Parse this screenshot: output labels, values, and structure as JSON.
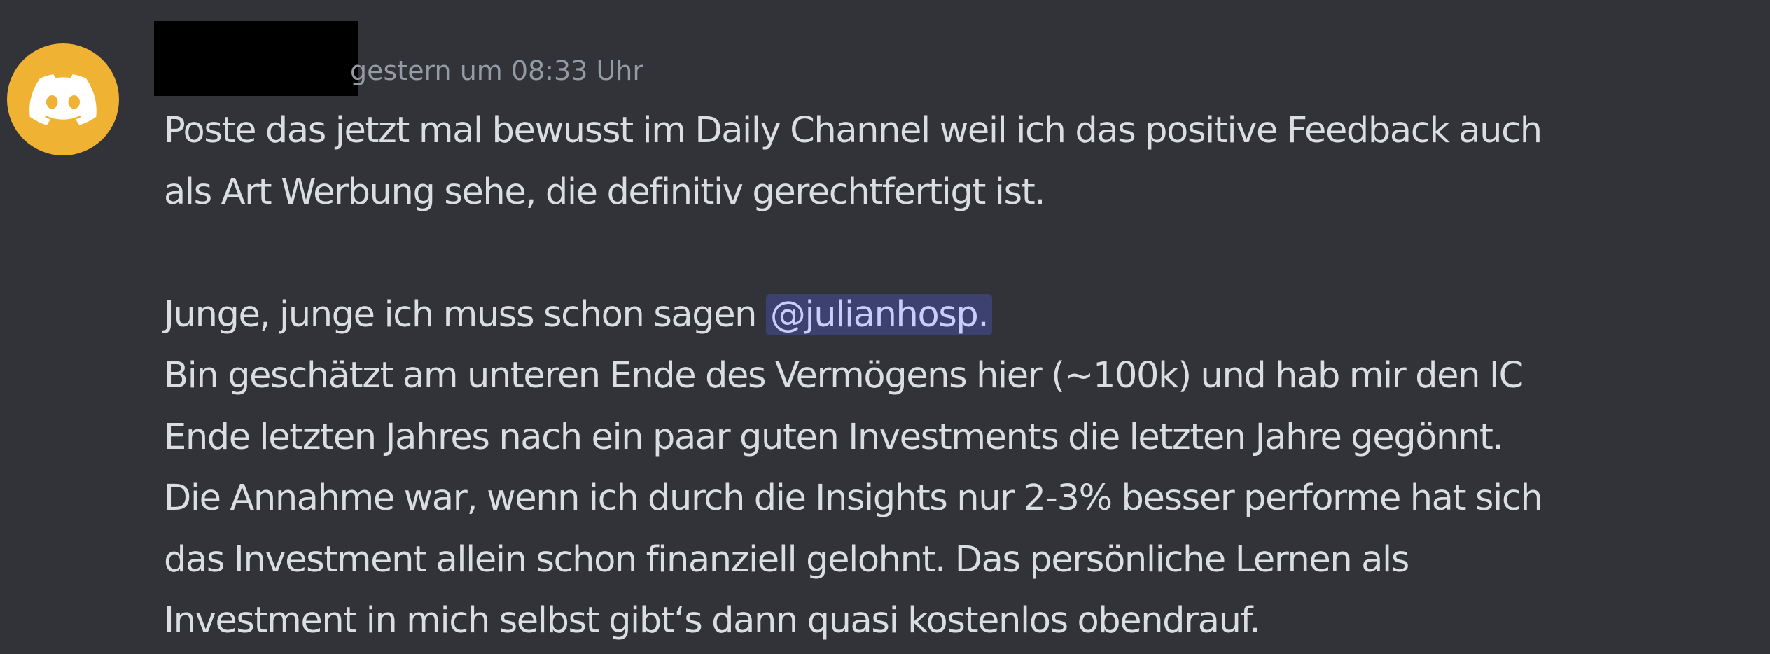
{
  "message": {
    "avatar_icon": "discord-logo-icon",
    "avatar_color": "#f0b232",
    "timestamp": "gestern um 08:33 Uhr",
    "paragraph1": [
      "Poste das jetzt mal bewusst im Daily Channel weil ich das positive Feedback auch",
      "als Art Werbung sehe, die definitiv gerechtfertigt ist."
    ],
    "line3_prefix": "Junge, junge ich muss schon sagen ",
    "mention": "@julianhosp.",
    "paragraph2": [
      "Bin geschätzt am unteren Ende des Vermögens hier (~100k) und hab mir den IC",
      "Ende letzten Jahres nach ein paar guten Investments die letzten Jahre gegönnt.",
      "Die Annahme war, wenn ich durch die Insights nur 2-3% besser performe hat sich",
      "das Investment allein schon finanziell gelohnt. Das persönliche Lernen als",
      "Investment in mich selbst gibt‘s dann quasi kostenlos obendrauf."
    ]
  }
}
